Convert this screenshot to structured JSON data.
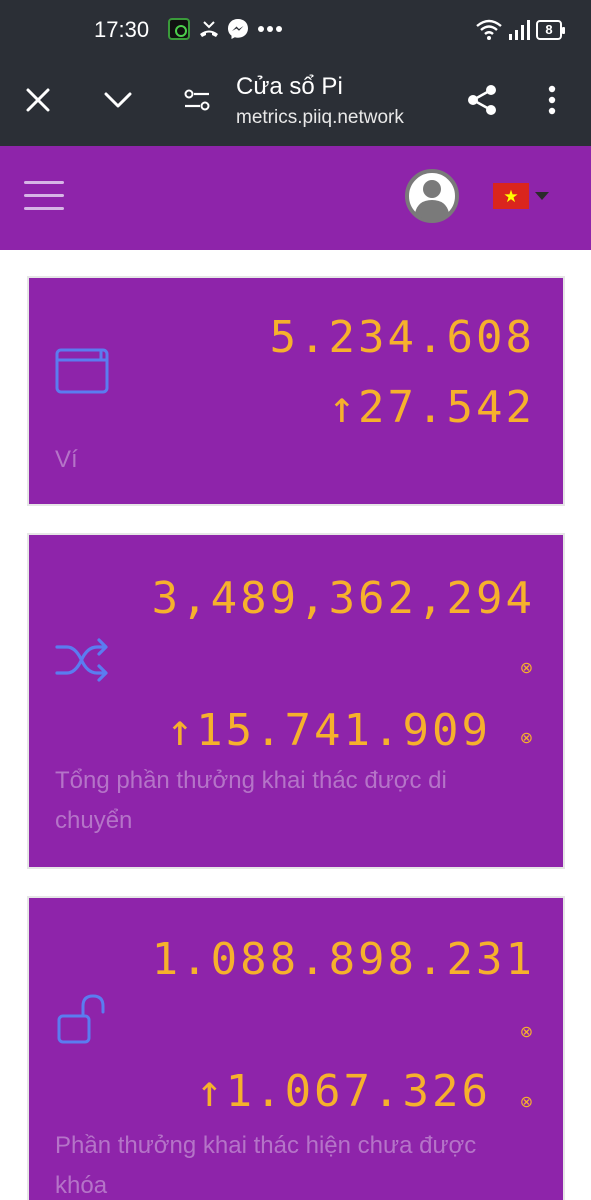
{
  "status_bar": {
    "time": "17:30",
    "battery": "8",
    "icons": [
      "app-notification-icon",
      "missed-call-icon",
      "messenger-icon",
      "more-notifications-icon",
      "wifi-icon",
      "signal-icon",
      "battery-icon"
    ]
  },
  "browser": {
    "title": "Cửa sổ Pi",
    "url": "metrics.piiq.network",
    "icons": [
      "close-icon",
      "chevron-down-icon",
      "site-settings-icon",
      "share-icon",
      "more-vert-icon"
    ]
  },
  "header": {
    "icons": [
      "hamburger-menu-icon",
      "account-avatar-icon",
      "vietnam-flag-icon"
    ],
    "language_flag_star": "★"
  },
  "cards": [
    {
      "value": "5.234.608",
      "delta": "↑27.542",
      "label": "Ví",
      "icon": "wallet-icon"
    },
    {
      "value": "3,489,362,294",
      "delta": "↑15.741.909",
      "label": "Tổng phần thưởng khai thác được di chuyển",
      "icon": "shuffle-icon",
      "marker": "⊗"
    },
    {
      "value": "1.088.898.231",
      "delta": "↑1.067.326",
      "label": "Phần thưởng khai thác hiện chưa được khóa",
      "icon": "unlocked-icon",
      "marker": "⊗"
    }
  ],
  "colors": {
    "status_bar_bg": "#2b2f36",
    "header_bg": "#8e24aa",
    "card_bg": "#8e24aa",
    "value_text": "#f6b12c",
    "label_text": "#b574c8",
    "icon_blue": "#5b7cf0"
  }
}
